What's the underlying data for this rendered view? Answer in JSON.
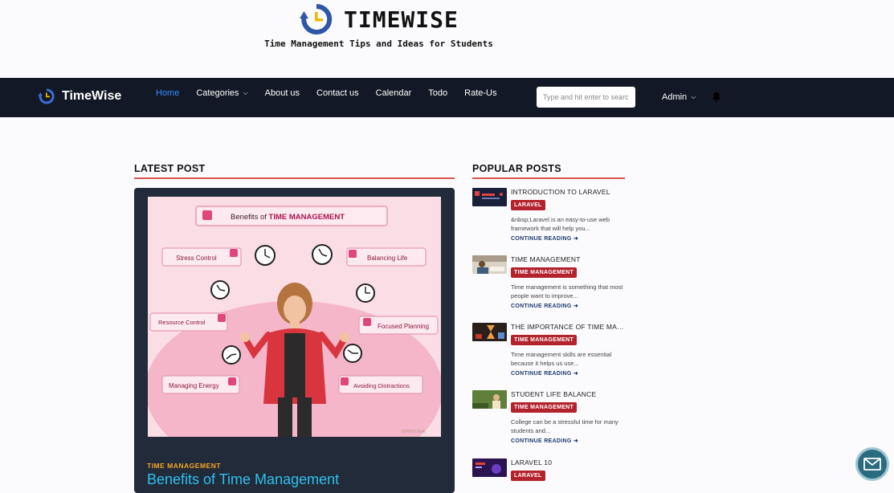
{
  "brand": {
    "title": "TIMEWISE",
    "tagline": "Time Management Tips and Ideas for Students"
  },
  "navbar": {
    "logo_text": "TimeWise",
    "links": [
      {
        "label": "Home",
        "active": true
      },
      {
        "label": "Categories",
        "has_dropdown": true
      },
      {
        "label": "About us"
      },
      {
        "label": "Contact us"
      },
      {
        "label": "Calendar"
      },
      {
        "label": "Todo"
      },
      {
        "label": "Rate-Us"
      }
    ],
    "search_placeholder": "Type and hit enter to search",
    "user_label": "Admin",
    "bell_icon": "bell-icon"
  },
  "latest": {
    "heading": "LATEST POST",
    "category": "TIME MANAGEMENT",
    "title": "Benefits of Time Management",
    "image": {
      "headline_prefix": "Benefits of ",
      "headline_bold": "TIME MANAGEMENT",
      "labels": {
        "stress": "Stress Control",
        "balance": "Balancing Life",
        "resource": "Resource Control",
        "focus": "Focused Planning",
        "energy": "Managing Energy",
        "distraction": "Avoiding Distractions"
      },
      "credit": "SPRINTZEAL"
    }
  },
  "popular": {
    "heading": "POPULAR POSTS",
    "continue_label": "CONTINUE READING",
    "items": [
      {
        "title": "INTRODUCTION TO LARAVEL",
        "badge": "LARAVEL",
        "excerpt": "&nbsp;Laravel is an easy-to-use web framework that will help you...",
        "thumb": "laravel-thumb"
      },
      {
        "title": "TIME MANAGEMENT",
        "badge": "TIME MANAGEMENT",
        "excerpt": "Time management is something that most people want to improve...",
        "thumb": "study-thumb"
      },
      {
        "title": "THE IMPORTANCE OF TIME MAN...",
        "badge": "TIME MANAGEMENT",
        "excerpt": "Time management skills are essential because it helps us use...",
        "thumb": "hourglass-thumb"
      },
      {
        "title": "STUDENT LIFE BALANCE",
        "badge": "TIME MANAGEMENT",
        "excerpt": "College can be a stressful time for many students and...",
        "thumb": "student-thumb"
      },
      {
        "title": "LARAVEL 10",
        "badge": "LARAVEL",
        "excerpt": "",
        "thumb": "laravel10-thumb"
      }
    ]
  },
  "colors": {
    "navbar_bg": "#121826",
    "accent_red": "#d9534f",
    "badge_red": "#b3232d",
    "active_link": "#3a8dff",
    "latest_title": "#2fc0ee",
    "latest_category": "#f5a623"
  },
  "chat_icon": "mail-icon"
}
